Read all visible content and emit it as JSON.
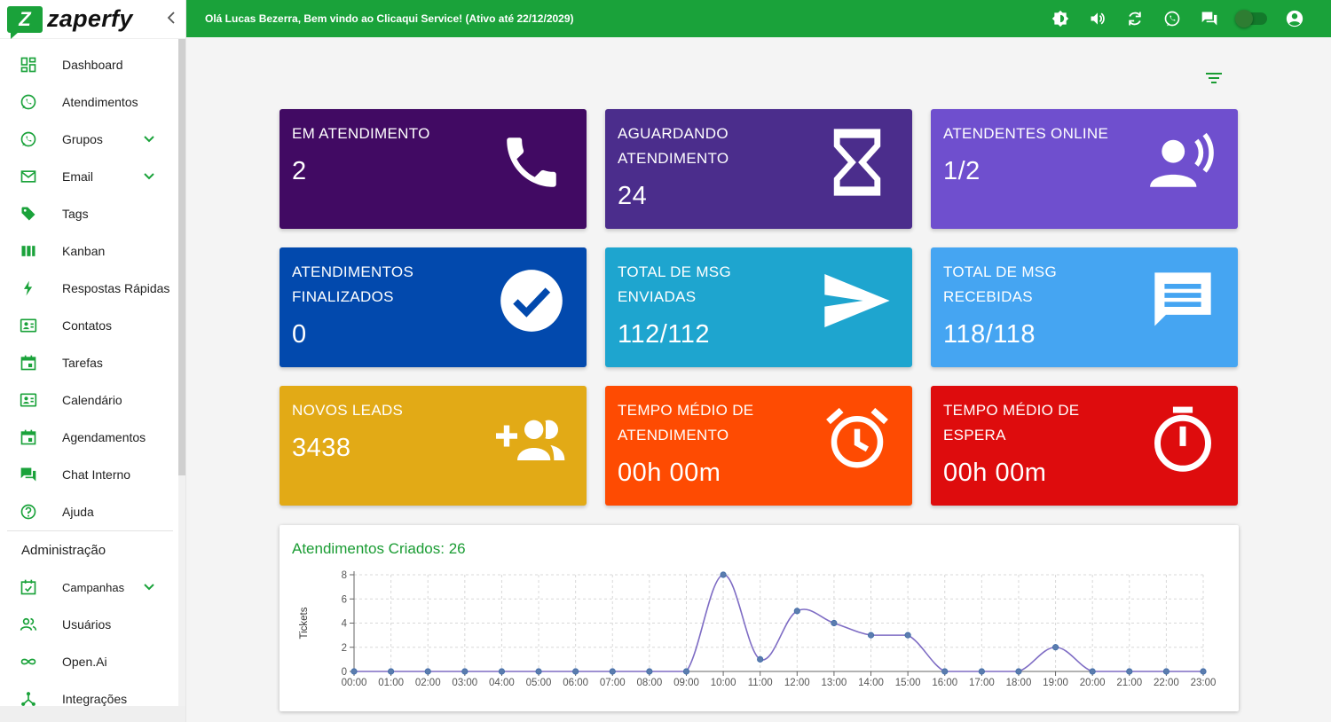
{
  "app": {
    "logo_letter": "Z",
    "logo_text": "zaperfy"
  },
  "header": {
    "welcome": "Olá Lucas Bezerra, Bem vindo ao Clicaqui Service! (Ativo até 22/12/2029)"
  },
  "sidebar": {
    "items": [
      {
        "label": "Dashboard",
        "icon": "dashboard-icon"
      },
      {
        "label": "Atendimentos",
        "icon": "whatsapp-icon"
      },
      {
        "label": "Grupos",
        "icon": "whatsapp-icon",
        "expandable": true
      },
      {
        "label": "Email",
        "icon": "email-icon",
        "expandable": true
      },
      {
        "label": "Tags",
        "icon": "tag-icon"
      },
      {
        "label": "Kanban",
        "icon": "kanban-icon"
      },
      {
        "label": "Respostas Rápidas",
        "icon": "bolt-icon"
      },
      {
        "label": "Contatos",
        "icon": "contacts-icon"
      },
      {
        "label": "Tarefas",
        "icon": "calendar-icon"
      },
      {
        "label": "Calendário",
        "icon": "contacts-icon"
      },
      {
        "label": "Agendamentos",
        "icon": "calendar-icon"
      },
      {
        "label": "Chat Interno",
        "icon": "chat-icon"
      },
      {
        "label": "Ajuda",
        "icon": "help-icon"
      }
    ],
    "admin_title": "Administração",
    "admin_items": [
      {
        "label": "Campanhas",
        "icon": "campaign-icon",
        "expandable": true
      },
      {
        "label": "Usuários",
        "icon": "users-icon"
      },
      {
        "label": "Open.Ai",
        "icon": "infinity-icon"
      },
      {
        "label": "Integrações",
        "icon": "integrations-icon"
      }
    ]
  },
  "cards": [
    {
      "title": "EM ATENDIMENTO",
      "value": "2",
      "color": "#410a63",
      "icon": "phone-icon"
    },
    {
      "title": "AGUARDANDO ATENDIMENTO",
      "value": "24",
      "color": "#4b2d8c",
      "icon": "hourglass-icon"
    },
    {
      "title": "ATENDENTES ONLINE",
      "value": "1/2",
      "color": "#6f4fce",
      "icon": "speaking-person-icon"
    },
    {
      "title": "ATENDIMENTOS FINALIZADOS",
      "value": "0",
      "color": "#0249ad",
      "icon": "check-circle-icon"
    },
    {
      "title": "TOTAL DE MSG ENVIADAS",
      "value": "112/112",
      "color": "#1ea5cf",
      "icon": "send-icon"
    },
    {
      "title": "TOTAL DE MSG RECEBIDAS",
      "value": "118/118",
      "color": "#45a5f2",
      "icon": "message-icon"
    },
    {
      "title": "NOVOS LEADS",
      "value": "3438",
      "color": "#e2aa16",
      "icon": "add-group-icon"
    },
    {
      "title": "TEMPO MÉDIO DE ATENDIMENTO",
      "value": "00h 00m",
      "color": "#fe4b02",
      "icon": "alarm-icon"
    },
    {
      "title": "TEMPO MÉDIO DE ESPERA",
      "value": "00h 00m",
      "color": "#de0c0d",
      "icon": "timer-icon"
    }
  ],
  "chart_data": {
    "type": "line",
    "title": "Atendimentos Criados: 26",
    "ylabel": "Tickets",
    "xlabel": "",
    "categories": [
      "00:00",
      "01:00",
      "02:00",
      "03:00",
      "04:00",
      "05:00",
      "06:00",
      "07:00",
      "08:00",
      "09:00",
      "10:00",
      "11:00",
      "12:00",
      "13:00",
      "14:00",
      "15:00",
      "16:00",
      "17:00",
      "18:00",
      "19:00",
      "20:00",
      "21:00",
      "22:00",
      "23:00"
    ],
    "values": [
      0,
      0,
      0,
      0,
      0,
      0,
      0,
      0,
      0,
      0,
      8,
      1,
      5,
      4,
      3,
      3,
      0,
      0,
      0,
      2,
      0,
      0,
      0,
      0
    ],
    "ylim": [
      0,
      8
    ],
    "yticks": [
      0,
      2,
      4,
      6,
      8
    ],
    "grid": true,
    "line_color": "#7e6cc4"
  }
}
